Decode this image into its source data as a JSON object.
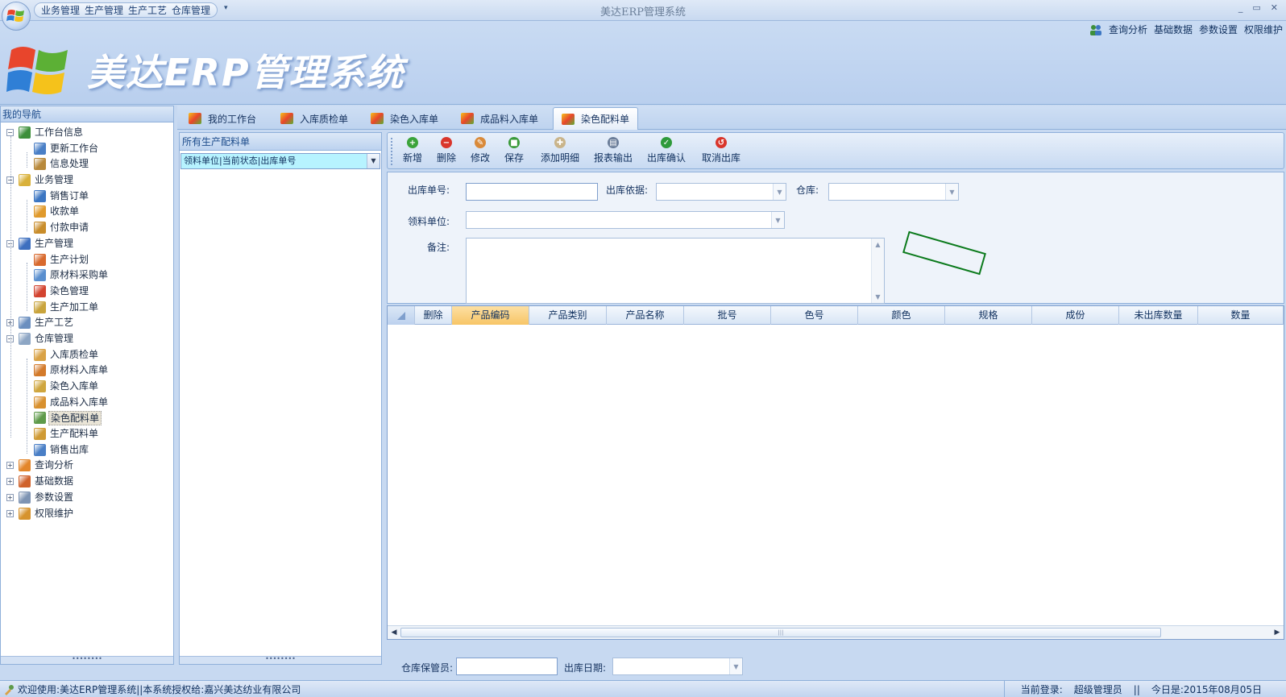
{
  "titlebar": {
    "quick_access": [
      "业务管理",
      "生产管理",
      "生产工艺",
      "仓库管理"
    ],
    "more": "▾",
    "title": "美达ERP管理系统",
    "minimize": "_",
    "restore": "▭",
    "close": "✕"
  },
  "header": {
    "links": [
      "查询分析",
      "基础数据",
      "参数设置",
      "权限维护"
    ],
    "big_title": "美达ERP管理系统"
  },
  "nav": {
    "heading": "我的导航",
    "tree": [
      {
        "level": 1,
        "label": "工作台信息",
        "expander": "−",
        "color": "#3d8f3a"
      },
      {
        "level": 2,
        "label": "更新工作台",
        "color": "#4a7fc6"
      },
      {
        "level": 2,
        "label": "信息处理",
        "color": "#b8893b"
      },
      {
        "level": 1,
        "label": "业务管理",
        "expander": "−",
        "color": "#d9b13a"
      },
      {
        "level": 2,
        "label": "销售订单",
        "color": "#3c76c2"
      },
      {
        "level": 2,
        "label": "收款单",
        "color": "#e09a2c"
      },
      {
        "level": 2,
        "label": "付款申请",
        "color": "#c98d2b"
      },
      {
        "level": 1,
        "label": "生产管理",
        "expander": "−",
        "color": "#3d6fbf"
      },
      {
        "level": 2,
        "label": "生产计划",
        "color": "#d86a2e"
      },
      {
        "level": 2,
        "label": "原材料采购单",
        "color": "#5a8fcf"
      },
      {
        "level": 2,
        "label": "染色管理",
        "color": "#d3432f"
      },
      {
        "level": 2,
        "label": "生产加工单",
        "color": "#c9a43c"
      },
      {
        "level": 1,
        "label": "生产工艺",
        "expander": "+",
        "color": "#6b8fbf"
      },
      {
        "level": 1,
        "label": "仓库管理",
        "expander": "−",
        "color": "#8da6c4"
      },
      {
        "level": 2,
        "label": "入库质检单",
        "color": "#d9a245"
      },
      {
        "level": 2,
        "label": "原材料入库单",
        "color": "#d37a2a"
      },
      {
        "level": 2,
        "label": "染色入库单",
        "color": "#cfa63e"
      },
      {
        "level": 2,
        "label": "成品料入库单",
        "color": "#d8902e"
      },
      {
        "level": 2,
        "label": "染色配料单",
        "color": "#5e9a4a",
        "selected": true
      },
      {
        "level": 2,
        "label": "生产配料单",
        "color": "#cf9a33"
      },
      {
        "level": 2,
        "label": "销售出库",
        "color": "#4a7fc6"
      },
      {
        "level": 1,
        "label": "查询分析",
        "expander": "+",
        "color": "#e3862b"
      },
      {
        "level": 1,
        "label": "基础数据",
        "expander": "+",
        "color": "#d0622c"
      },
      {
        "level": 1,
        "label": "参数设置",
        "expander": "+",
        "color": "#7d93b3"
      },
      {
        "level": 1,
        "label": "权限维护",
        "expander": "+",
        "color": "#d6932e"
      }
    ],
    "footer_grip": "••••••••"
  },
  "tabs": [
    {
      "label": "我的工作台",
      "icon": "windows-logo-icon",
      "active": false
    },
    {
      "label": "入库质检单",
      "icon": "truck-icon",
      "active": false
    },
    {
      "label": "染色入库单",
      "icon": "diamond-icon",
      "active": false
    },
    {
      "label": "成品料入库单",
      "icon": "diamond-orange-icon",
      "active": false
    },
    {
      "label": "染色配料单",
      "icon": "tools-icon",
      "active": true
    }
  ],
  "list_panel": {
    "heading": "所有生产配料单",
    "combo_value": "领料单位|当前状态|出库单号",
    "footer_grip": "••••••••"
  },
  "toolbar": {
    "buttons": [
      {
        "label": "新增",
        "color": "#3aa33a",
        "glyph": "+"
      },
      {
        "label": "删除",
        "color": "#d9352b",
        "glyph": "−"
      },
      {
        "label": "修改",
        "color": "#d98a3a",
        "glyph": "✎"
      },
      {
        "label": "保存",
        "color": "#3a9a3a",
        "glyph": "■"
      },
      {
        "label": "添加明细",
        "color": "#c9b48a",
        "glyph": "✚"
      },
      {
        "label": "报表输出",
        "color": "#6a7d99",
        "glyph": "▤"
      },
      {
        "label": "出库确认",
        "color": "#2e9a3a",
        "glyph": "✓"
      },
      {
        "label": "取消出库",
        "color": "#d9352b",
        "glyph": "↺"
      }
    ]
  },
  "form": {
    "outbound_no_label": "出库单号:",
    "outbound_basis_label": "出库依据:",
    "warehouse_label": "仓库:",
    "receiving_unit_label": "领料单位:",
    "remarks_label": "备注:",
    "outbound_no_value": "",
    "remarks_value": ""
  },
  "grid": {
    "columns": [
      "删除",
      "产品编码",
      "产品类别",
      "产品名称",
      "批号",
      "色号",
      "颜色",
      "规格",
      "成份",
      "未出库数量",
      "数量"
    ],
    "sorted_column": "产品编码",
    "rows": []
  },
  "bottom_form": {
    "keeper_label": "仓库保管员:",
    "keeper_value": "",
    "date_label": "出库日期:"
  },
  "status": {
    "left": "欢迎使用:美达ERP管理系统||本系统授权给:嘉兴美达纺业有限公司",
    "login_label": "当前登录:",
    "login_user": "超级管理员",
    "divider": "||",
    "today": "今日是:2015年08月05日"
  }
}
